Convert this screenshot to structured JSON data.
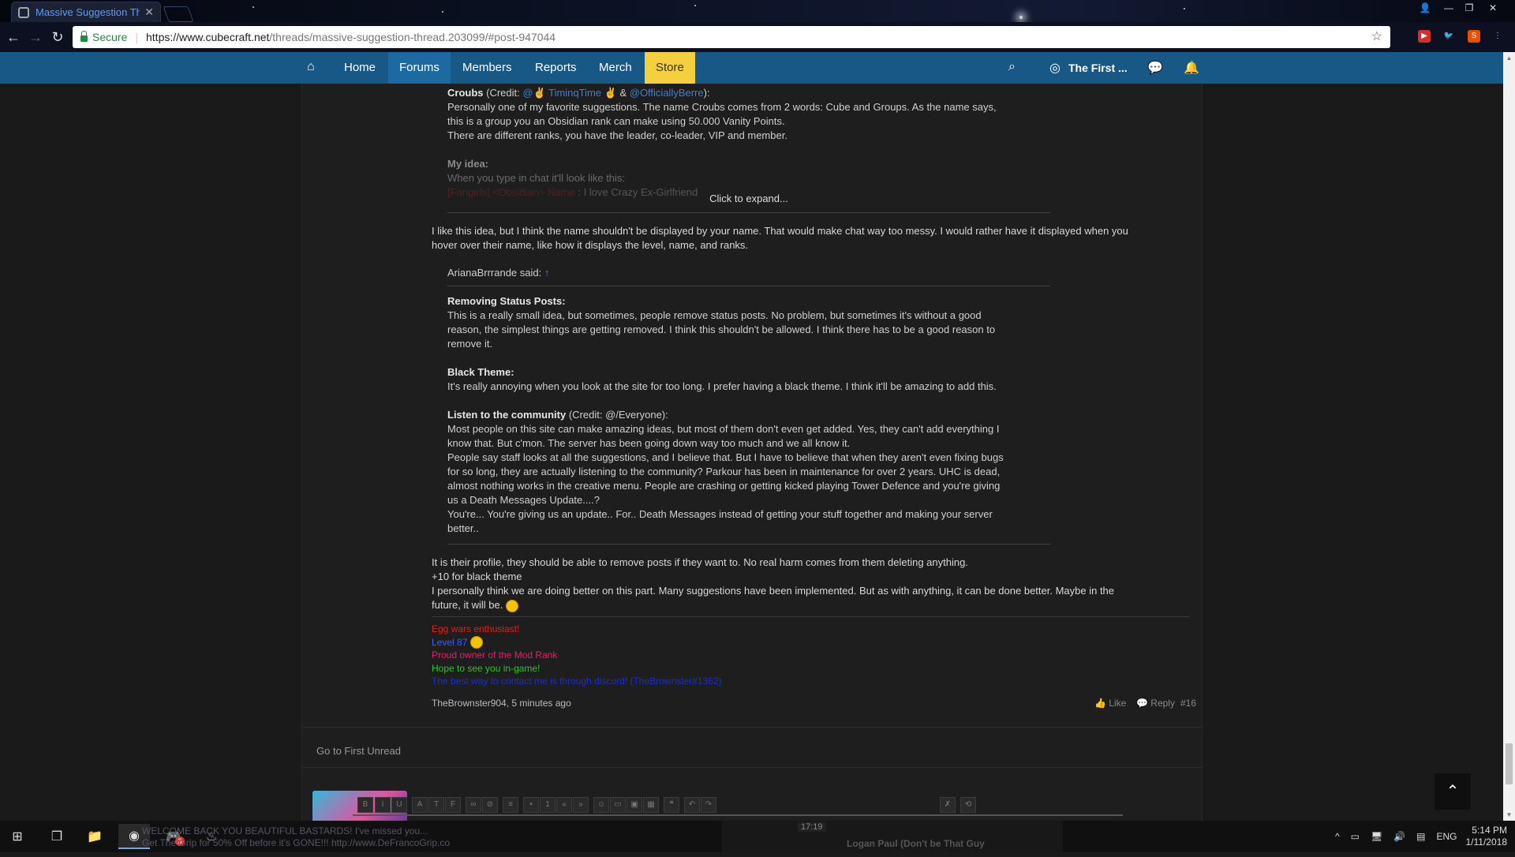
{
  "browser": {
    "tab_title": "Massive Suggestion Thre",
    "secure_label": "Secure",
    "url_host": "https://www.cubecraft.net",
    "url_path": "/threads/massive-suggestion-thread.203099/#post-947044"
  },
  "nav": {
    "items": [
      "Home",
      "Forums",
      "Members",
      "Reports",
      "Merch",
      "Store"
    ],
    "user_label": "The First ..."
  },
  "quote1": {
    "title": "Croubs",
    "credit_prefix": " (Credit: ",
    "credit_user1": "@✌ TiminqTime ✌",
    "credit_and": " & ",
    "credit_user2": "@OfficiallyBerre",
    "credit_suffix": "):",
    "line1": "Personally one of my favorite suggestions. The name Croubs comes from 2 words: Cube and Groups. As the name says,",
    "line2": "this is a group you an Obsidian rank can make using 50.000 Vanity Points.",
    "line3": "There are different ranks, you have the leader, co-leader, VIP and member.",
    "idea_title": "My idea:",
    "idea_line": "When you type in chat it'll look like this:",
    "faded_red": "[Fangirls] <Obsidian> Name",
    "faded_text": " : I love Crazy Ex-Girlfriend",
    "expand": "Click to expand..."
  },
  "reply1": {
    "line1": "I like this idea, but I think the name shouldn't be displayed by your name. That would make chat way too messy. I would rather have it displayed when you",
    "line2": "hover over their name, like how it displays the level, name, and ranks."
  },
  "quote2": {
    "author": "ArianaBrrrande said: ",
    "arrow": "↑",
    "s1_title": "Removing Status Posts:",
    "s1_l1": "This is a really small idea, but sometimes, people remove status posts. No problem, but sometimes it's without a good",
    "s1_l2": "reason, the simplest things are getting removed. I think this shouldn't be allowed. I think there has to be a good reason to",
    "s1_l3": "remove it.",
    "s2_title": "Black Theme:",
    "s2_l1": "It's really annoying when you look at the site for too long. I prefer having a black theme. I think it'll be amazing to add this.",
    "s3_title": "Listen to the community",
    "s3_credit": " (Credit: @/Everyone):",
    "s3_l1": "Most people on this site can make amazing ideas, but most of them don't even get added. Yes, they can't add everything I",
    "s3_l2": "know that. But c'mon. The server has been going down way too much and we all know it.",
    "s3_l3": "People say staff looks at all the suggestions, and I believe that. But I have to believe that when they aren't even fixing bugs",
    "s3_l4": "for so long, they are actually listening to the community? Parkour has been in maintenance for over 2 years. UHC is dead,",
    "s3_l5": "almost nothing works in the creative menu. People are crashing or getting kicked playing Tower Defence and you're giving",
    "s3_l6": "us a Death Messages Update....?",
    "s3_l7": "You're... You're giving us an update.. For.. Death Messages instead of getting your stuff together and making your server",
    "s3_l8": "better.."
  },
  "reply2": {
    "line1": "It is their profile, they should be able to remove posts if they want to. No real harm comes from them deleting anything.",
    "line2": "+10 for black theme",
    "line3": "I personally think we are doing better on this part. Many suggestions have been implemented. But as with anything, it can be done better. Maybe in the",
    "line4": "future, it will be. "
  },
  "signature": {
    "l1": "Egg wars enthusiast!",
    "l2": "Level 87 ",
    "l3": "Proud owner of the Mod Rank",
    "l4": "Hope to see you in-game!",
    "l5": "The best way to contact me is through discord! (TheBrownster#1362)",
    "colors": {
      "l1": "#e02020",
      "l2": "#3a5fff",
      "l3": "#e0206a",
      "l4": "#1fcc1f",
      "l5": "#1a2fcf"
    }
  },
  "post_meta": {
    "byline": "TheBrownster904, 5 minutes ago",
    "like": "Like",
    "reply": "Reply",
    "number": "#16"
  },
  "go_first": "Go to First Unread",
  "taskbar": {
    "preview1_l1": "WELCOME BACK YOU BEAUTIFUL BASTARDS! I've missed you...",
    "preview1_l2": "Get The Grip for 50% Off before it's GONE!!! http://www.DeFrancoGrip.com",
    "preview2_time": "17:19",
    "preview2_title": "Logan Paul (Don't be That Guy",
    "lang": "ENG",
    "time": "5:14 PM",
    "date": "1/11/2018",
    "discord_badge": "3"
  }
}
